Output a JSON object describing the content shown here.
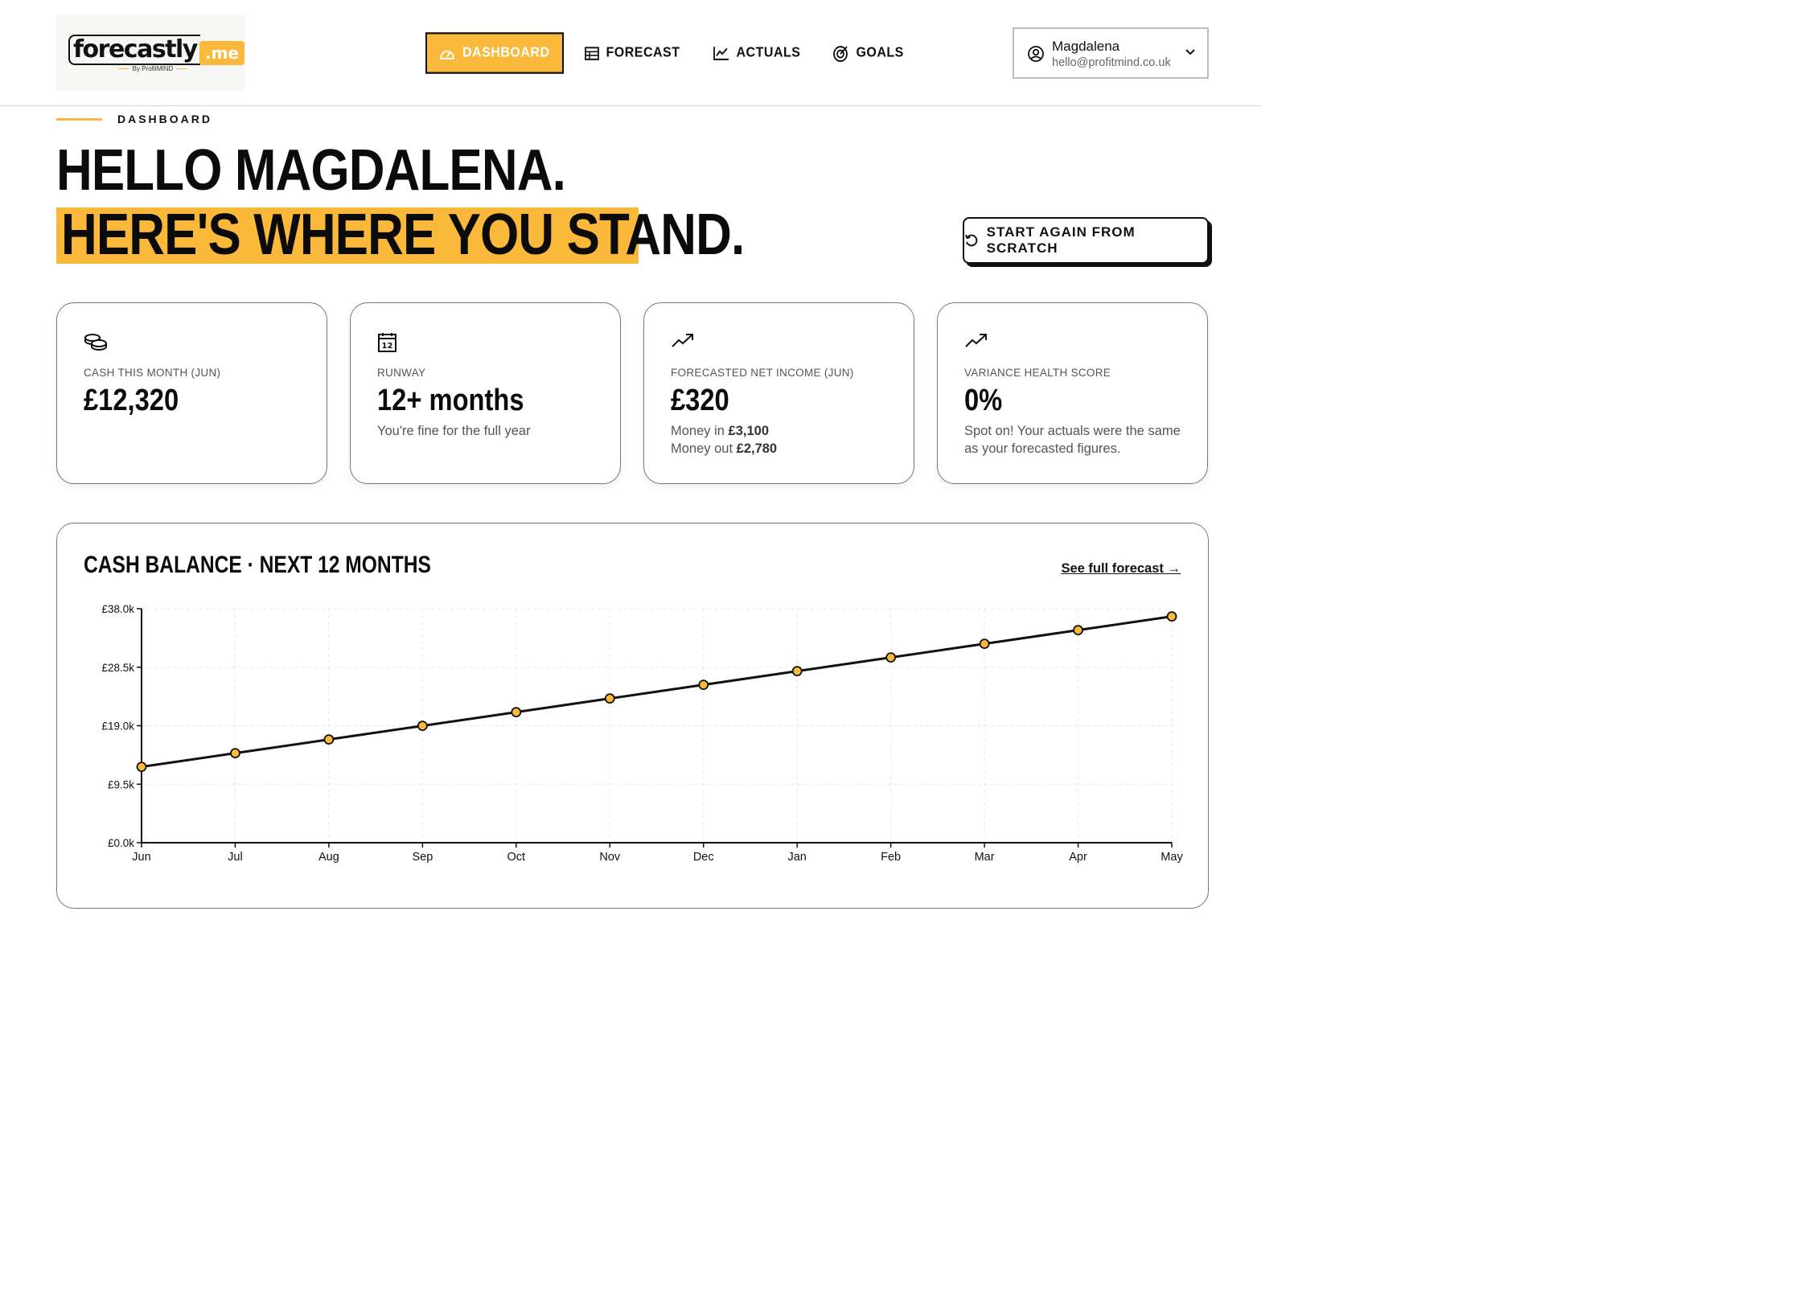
{
  "brand": {
    "logo_text": "forecastly",
    "logo_suffix": ".me",
    "logo_tagline": "By ProfitMIND"
  },
  "nav": {
    "items": [
      {
        "label": "DASHBOARD",
        "icon": "gauge-icon",
        "active": true
      },
      {
        "label": "FORECAST",
        "icon": "table-icon",
        "active": false
      },
      {
        "label": "ACTUALS",
        "icon": "line-chart-icon",
        "active": false
      },
      {
        "label": "GOALS",
        "icon": "target-icon",
        "active": false
      }
    ]
  },
  "user": {
    "name": "Magdalena",
    "email": "hello@profitmind.co.uk"
  },
  "hero": {
    "eyebrow": "DASHBOARD",
    "line1": "HELLO MAGDALENA.",
    "line2": "HERE'S WHERE YOU STAND.",
    "restart_label": "START AGAIN FROM SCRATCH"
  },
  "cards": [
    {
      "icon": "coins-icon",
      "label": "CASH THIS MONTH (JUN)",
      "value": "£12,320"
    },
    {
      "icon": "calendar-icon",
      "label": "RUNWAY",
      "value": "12+ months",
      "sub": "You're fine for the full year"
    },
    {
      "icon": "trend-up-icon",
      "label": "FORECASTED NET INCOME (JUN)",
      "value": "£320",
      "sub_in_label": "Money in ",
      "sub_in_value": "£3,100",
      "sub_out_label": "Money out ",
      "sub_out_value": "£2,780"
    },
    {
      "icon": "trend-up-icon",
      "label": "VARIANCE HEALTH SCORE",
      "value": "0%",
      "sub": "Spot on! Your actuals were the same as your forecasted figures."
    }
  ],
  "chart_panel": {
    "title": "CASH BALANCE · NEXT 12 MONTHS",
    "link": "See full forecast →"
  },
  "colors": {
    "accent": "#fbb93c",
    "ink": "#111111"
  },
  "chart_data": {
    "type": "line",
    "categories": [
      "Jun",
      "Jul",
      "Aug",
      "Sep",
      "Oct",
      "Nov",
      "Dec",
      "Jan",
      "Feb",
      "Mar",
      "Apr",
      "May"
    ],
    "values": [
      12320,
      14540,
      16760,
      18980,
      21200,
      23420,
      25640,
      27860,
      30080,
      32300,
      34520,
      36740
    ],
    "yticks": [
      "£0.0k",
      "£9.5k",
      "£19.0k",
      "£28.5k",
      "£38.0k"
    ],
    "ylim": [
      0,
      38000
    ],
    "grid": true,
    "marker_color": "#fbb93c",
    "line_color": "#111111"
  }
}
